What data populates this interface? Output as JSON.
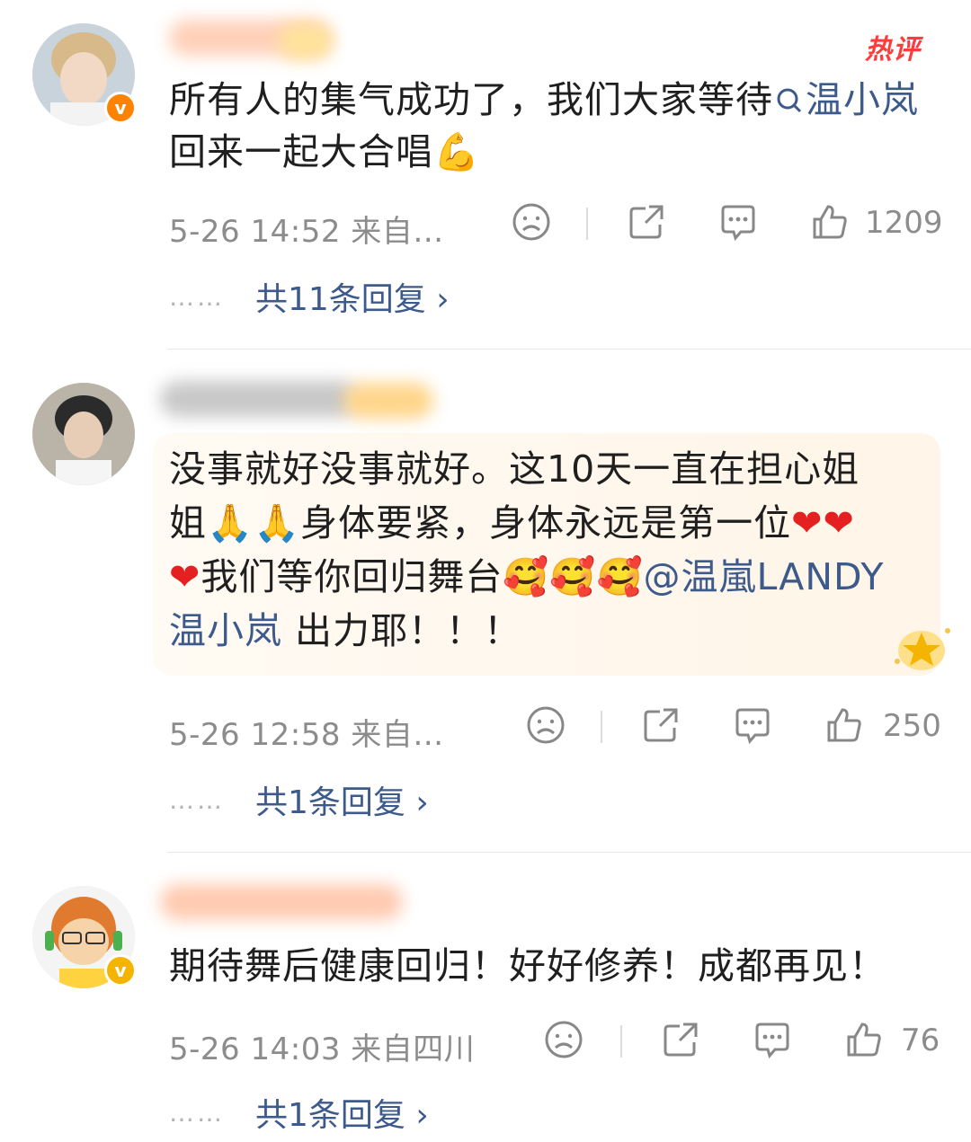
{
  "comments": [
    {
      "badge": "热评",
      "text_main": "所有人的集气成功了，我们大家等待",
      "text_link": "温小岚",
      "text_tail": " 回来一起大合唱",
      "emoji_tail": "💪",
      "meta": "5-26 14:52  来自…",
      "likes": "1209",
      "replies_label": "共11条回复 ›",
      "dots": "……"
    },
    {
      "line1": "没事就好没事就好。这10天一直在担心姐",
      "line2_a": "姐",
      "line2_emoji": "🙏🙏",
      "line2_b": "身体要紧，身体永远是第一位",
      "line2_hearts": "❤❤",
      "line3_heart": "❤",
      "line3_a": "我们等你回归舞台",
      "line3_emoji": "🥰🥰🥰",
      "line3_mention": "@温嵐LANDY",
      "line4_link": "温小岚",
      "line4_tail": " 出力耶！！！",
      "meta": "5-26 12:58  来自…",
      "likes": "250",
      "replies_label": "共1条回复 ›",
      "dots": "……"
    },
    {
      "text": "期待舞后健康回归！好好修养！成都再见！",
      "meta": "5-26 14:03  来自四川",
      "likes": "76",
      "replies_label": "共1条回复 ›",
      "dots": "……"
    }
  ],
  "icons": [
    "sad-face-icon",
    "share-icon",
    "comment-icon",
    "thumbs-up-icon",
    "verified-v-icon",
    "search-icon"
  ],
  "colors": {
    "link": "#3d5a8c",
    "meta": "#8c8c8c",
    "hot": "#ff3b3b",
    "verified": "#ff8200"
  }
}
